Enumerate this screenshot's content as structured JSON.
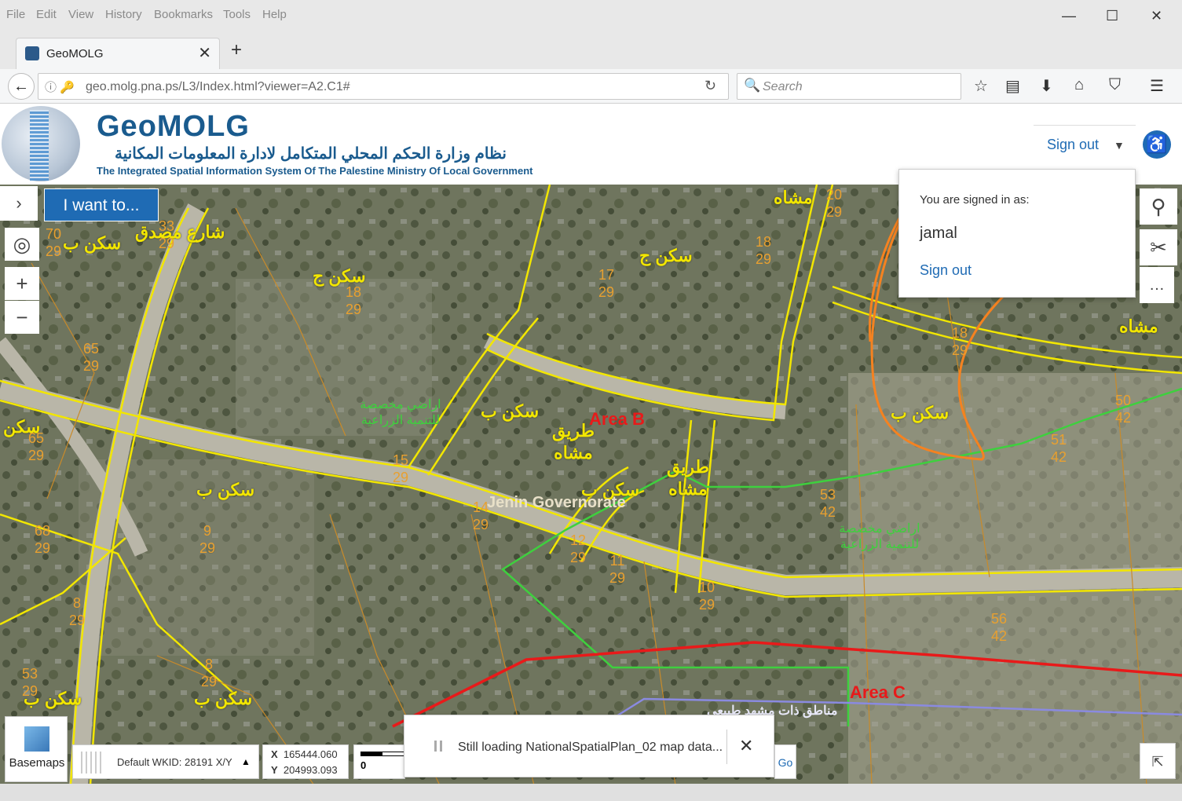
{
  "browser": {
    "menu": [
      "File",
      "Edit",
      "View",
      "History",
      "Bookmarks",
      "Tools",
      "Help"
    ],
    "tab_title": "GeoMOLG",
    "url": "geo.molg.pna.ps/L3/Index.html?viewer=A2.C1#",
    "search_placeholder": "Search"
  },
  "header": {
    "title": "GeoMOLG",
    "subtitle_ar": "نظام وزارة الحكم المحلي المتكامل لادارة المعلومات المكانية",
    "subtitle_en": "The Integrated Spatial Information System Of The Palestine Ministry Of Local Government",
    "signout_label": "Sign out"
  },
  "toolbar": {
    "i_want_to": "I want to..."
  },
  "user_menu": {
    "signed_in_label": "You are signed in as:",
    "username": "jamal",
    "signout_link": "Sign out"
  },
  "map_labels": {
    "street": "شارع مصدق",
    "zone_b1": "سكن ب",
    "zone_j1": "سكن ج",
    "zone_j2": "سكن ج",
    "walk1": "مشاه",
    "walk2": "مشاه",
    "zone_b2": "سكن ب",
    "zone_b3": "سكن ب",
    "zone_b4": "سكن ب",
    "zone_b5": "سكن ب",
    "zone_b6": "سكن ب",
    "zone_b7": "سكن ب",
    "road_walk1": "طريق مشاه",
    "road_walk2": "طريق مشاه",
    "zone_s": "سكن",
    "area_b": "Area B",
    "area_c": "Area C",
    "jenin": "Jenin Governorate",
    "green1": "اراضي مخصصة للتنمية الزراعية",
    "green2": "اراضي مخصصة للتنمية الزراعية",
    "blue_label": "مناطق ذات مشهد طبيعي",
    "parcel_labels": [
      {
        "id": "p1",
        "t": "70\n29"
      },
      {
        "id": "p2",
        "t": "33\n29"
      },
      {
        "id": "p3",
        "t": "18\n29"
      },
      {
        "id": "p4",
        "t": "65\n29"
      },
      {
        "id": "p5",
        "t": "65\n29"
      },
      {
        "id": "p6",
        "t": "15\n29"
      },
      {
        "id": "p7",
        "t": "17\n29"
      },
      {
        "id": "p8",
        "t": "18\n29"
      },
      {
        "id": "p9",
        "t": "18\n29"
      },
      {
        "id": "p10",
        "t": "20\n29"
      },
      {
        "id": "p11",
        "t": "14\n29"
      },
      {
        "id": "p12",
        "t": "9\n29"
      },
      {
        "id": "p13",
        "t": "68\n29"
      },
      {
        "id": "p14",
        "t": "8\n29"
      },
      {
        "id": "p15",
        "t": "8\n29"
      },
      {
        "id": "p16",
        "t": "53\n29"
      },
      {
        "id": "p17",
        "t": "12\n29"
      },
      {
        "id": "p18",
        "t": "11\n29"
      },
      {
        "id": "p19",
        "t": "10\n29"
      },
      {
        "id": "p20",
        "t": "53\n42"
      },
      {
        "id": "p21",
        "t": "51\n42"
      },
      {
        "id": "p22",
        "t": "50\n42"
      },
      {
        "id": "p23",
        "t": "56\n42"
      }
    ]
  },
  "bottom": {
    "basemaps_label": "Basemaps",
    "wkid_label": "Default WKID: 28191 X/Y",
    "x_label": "X",
    "x_value": "165444.060",
    "y_label": "Y",
    "y_value": "204993.093",
    "scale_zero": "0",
    "toast_text": "Still loading NationalSpatialPlan_02 map data...",
    "go_label": "Go"
  },
  "colors": {
    "brand": "#1f6bb4",
    "parcel_yellow": "#f2e600",
    "parcel_orange": "#e8a030",
    "area_red": "#e81a1a",
    "area_green": "#3ed03e",
    "annotation_orange": "#f58220"
  }
}
